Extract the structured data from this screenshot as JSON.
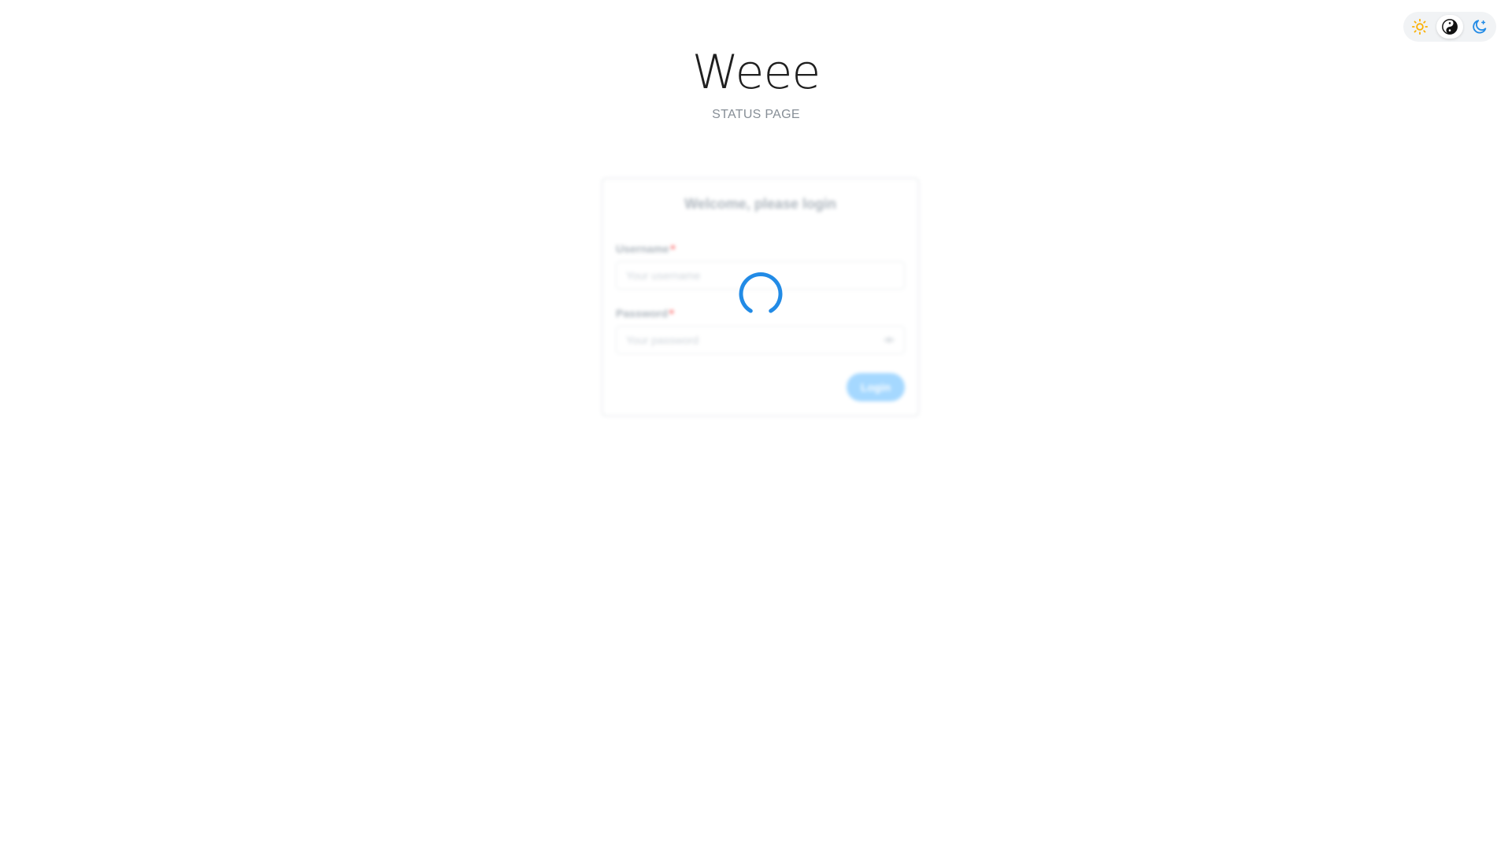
{
  "theme_switch": {
    "options": [
      "light",
      "auto",
      "dark"
    ],
    "active": "auto"
  },
  "brand": {
    "title": "Weee",
    "subtitle": "STATUS PAGE"
  },
  "login": {
    "heading": "Welcome, please login",
    "username_label": "Username",
    "username_placeholder": "Your username",
    "password_label": "Password",
    "password_placeholder": "Your password",
    "required_mark": "*",
    "submit_label": "Login"
  },
  "colors": {
    "accent": "#228be6",
    "sun": "#fab005",
    "required": "#fa5252"
  },
  "state": {
    "loading": true
  }
}
